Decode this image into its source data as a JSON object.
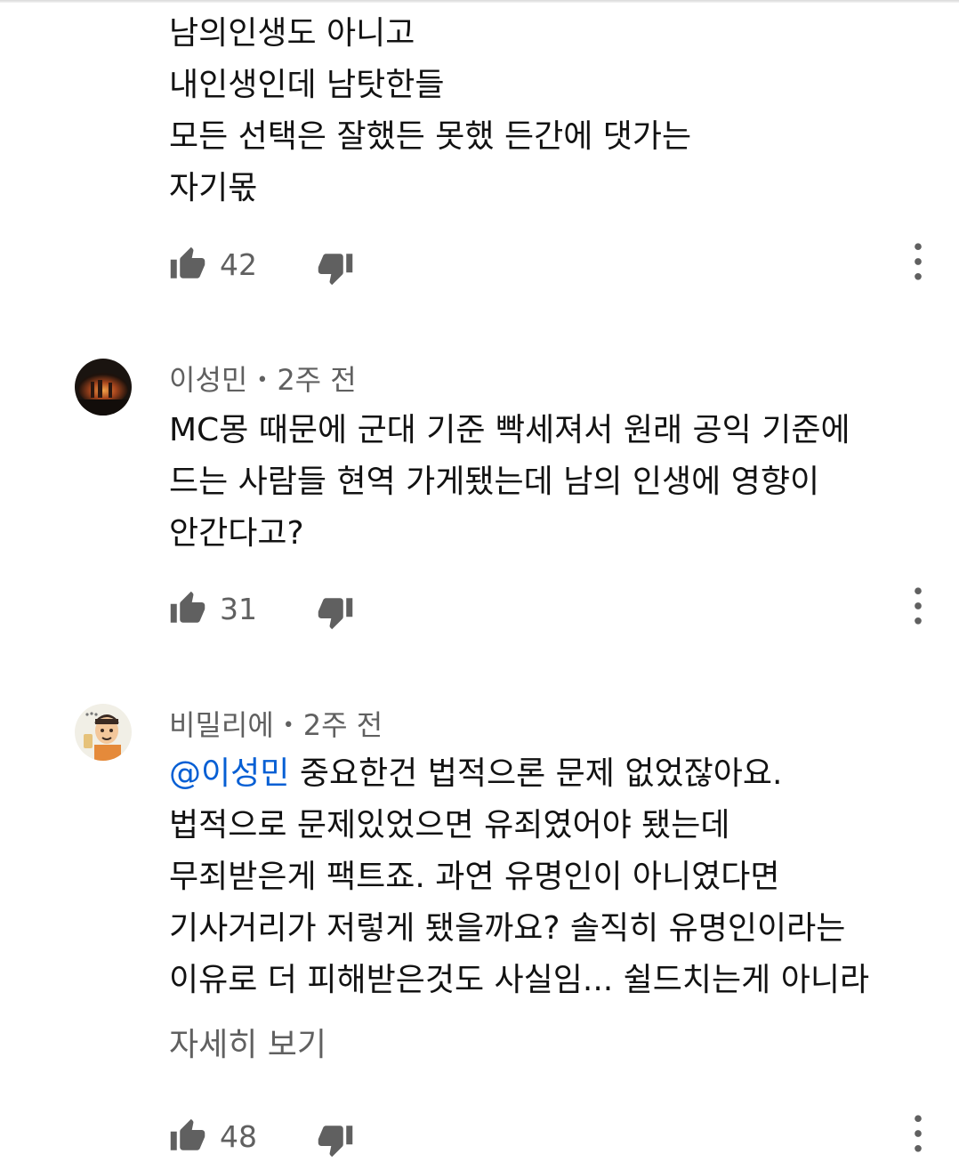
{
  "comments": [
    {
      "lines": [
        "남의인생도 아니고",
        "내인생인데 남탓한들",
        "모든 선택은 잘했든 못했 든간에 댓가는",
        "자기몫"
      ],
      "likes": "42"
    },
    {
      "author": "이성민",
      "time": "2주 전",
      "separator": "•",
      "lines": [
        "MC몽 때문에 군대 기준 빡세져서 원래 공익 기준에",
        "드는 사람들 현역 가게됐는데 남의 인생에 영향이",
        "안간다고?"
      ],
      "likes": "31"
    },
    {
      "author": "비밀리에",
      "time": "2주 전",
      "separator": "•",
      "mention": "@이성민",
      "first_line_rest": " 중요한건 법적으론 문제 없었잖아요.",
      "lines": [
        "법적으로 문제있었으면 유죄였어야 됐는데",
        "무죄받은게 팩트죠. 과연 유명인이 아니였다면",
        "기사거리가 저렇게 됐을까요? 솔직히 유명인이라는",
        "이유로 더 피해받은것도 사실임... 쉴드치는게 아니라"
      ],
      "show_more": "자세히 보기",
      "likes": "48"
    }
  ],
  "icons": {
    "like": "thumbs-up-icon",
    "dislike": "thumbs-down-icon",
    "more": "more-vertical-icon"
  },
  "colors": {
    "text": "#121212",
    "secondary": "#606060",
    "mention": "#065fd4",
    "icon": "#606060"
  }
}
